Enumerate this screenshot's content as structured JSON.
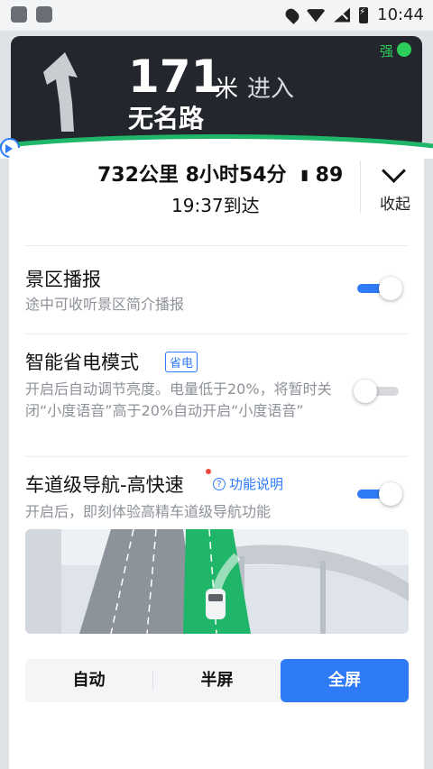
{
  "status_bar": {
    "time": "10:44"
  },
  "nav": {
    "distance": "171",
    "unit": "米",
    "action": "进入",
    "road": "无名路",
    "gps_strength": "强"
  },
  "route": {
    "summary": "732公里 8小时54分",
    "lights_count": "89",
    "eta": "19:37到达",
    "collapse": "收起"
  },
  "settings": [
    {
      "title": "景区播报",
      "desc": "途中可收听景区简介播报",
      "enabled": true
    },
    {
      "title": "智能省电模式",
      "badge": "省电",
      "desc": "开启后自动调节亮度。电量低于20%，将暂时关闭“小度语音”高于20%自动开启“小度语音”",
      "enabled": false
    },
    {
      "title": "车道级导航-高快速",
      "help": "功能说明",
      "desc": "开启后，即刻体验高精车道级导航功能",
      "enabled": true
    }
  ],
  "display_modes": {
    "auto": "自动",
    "half": "半屏",
    "full": "全屏",
    "selected": "全屏"
  },
  "colors": {
    "accent": "#2f7bf6",
    "nav_bg": "#23272d",
    "gps_green": "#2ccf5a",
    "route_green": "#20b66a"
  }
}
